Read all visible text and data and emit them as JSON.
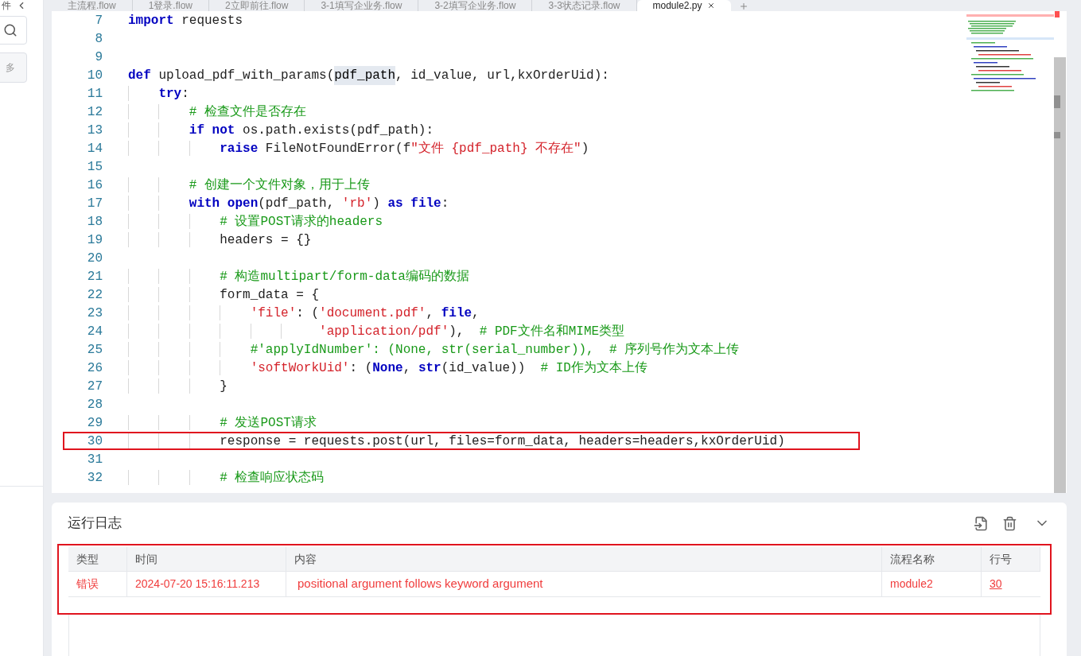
{
  "sidebar": {
    "label": "件",
    "button_label": "多"
  },
  "tabs": [
    {
      "label": "主流程.flow",
      "selected": false
    },
    {
      "label": "1登录.flow",
      "selected": false
    },
    {
      "label": "2立即前往.flow",
      "selected": false
    },
    {
      "label": "3-1填写企业务.flow",
      "selected": false
    },
    {
      "label": "3-2填写企业务.flow",
      "selected": false
    },
    {
      "label": "3-3状态记录.flow",
      "selected": false
    },
    {
      "label": "module2.py",
      "selected": true
    }
  ],
  "editor": {
    "lines": [
      {
        "number": "7",
        "annotated": false,
        "tokens": [
          {
            "kind": "kw",
            "text": "import"
          },
          {
            "kind": "plain",
            "text": " requests"
          }
        ]
      },
      {
        "number": "8",
        "annotated": false
      },
      {
        "number": "9",
        "annotated": false
      },
      {
        "number": "10",
        "annotated": false,
        "tokens": [
          {
            "kind": "kw",
            "text": "def"
          },
          {
            "kind": "plain",
            "text": " upload_pdf_with_params("
          },
          {
            "kind": "match",
            "text": "pdf_path"
          },
          {
            "kind": "plain",
            "text": ", id_value, url,kxOrderUid):"
          }
        ]
      },
      {
        "number": "11",
        "annotated": false,
        "tokens": [
          {
            "kind": "kw",
            "text": "    try"
          },
          {
            "kind": "plain",
            "text": ":"
          }
        ]
      },
      {
        "number": "12",
        "annotated": false,
        "tokens": [
          {
            "kind": "cmt",
            "text": "        # 检查文件是否存在"
          }
        ]
      },
      {
        "number": "13",
        "annotated": false,
        "tokens": [
          {
            "kind": "kw",
            "text": "        if"
          },
          {
            "kind": "kw",
            "text": " not"
          },
          {
            "kind": "plain",
            "text": " os.path.exists(pdf_path):"
          }
        ]
      },
      {
        "number": "14",
        "annotated": false,
        "tokens": [
          {
            "kind": "kw",
            "text": "            raise"
          },
          {
            "kind": "plain",
            "text": " FileNotFoundError(f"
          },
          {
            "kind": "str",
            "text": "\"文件 {pdf_path} 不存在\""
          },
          {
            "kind": "plain",
            "text": ")"
          }
        ]
      },
      {
        "number": "15",
        "annotated": false
      },
      {
        "number": "16",
        "annotated": false,
        "tokens": [
          {
            "kind": "cmt",
            "text": "        # 创建一个文件对象，用于上传"
          }
        ]
      },
      {
        "number": "17",
        "annotated": false,
        "tokens": [
          {
            "kind": "kw",
            "text": "        with"
          },
          {
            "kind": "kw",
            "text": " open"
          },
          {
            "kind": "plain",
            "text": "(pdf_path, "
          },
          {
            "kind": "str",
            "text": "'rb'"
          },
          {
            "kind": "plain",
            "text": ") "
          },
          {
            "kind": "kw",
            "text": "as"
          },
          {
            "kind": "kw",
            "text": " file"
          },
          {
            "kind": "plain",
            "text": ":"
          }
        ]
      },
      {
        "number": "18",
        "annotated": false,
        "tokens": [
          {
            "kind": "cmt",
            "text": "            # 设置POST请求的headers"
          }
        ]
      },
      {
        "number": "19",
        "annotated": false,
        "tokens": [
          {
            "kind": "plain",
            "text": "            headers = {}"
          }
        ]
      },
      {
        "number": "20",
        "annotated": false
      },
      {
        "number": "21",
        "annotated": false,
        "tokens": [
          {
            "kind": "cmt",
            "text": "            # 构造multipart/form-data编码的数据"
          }
        ]
      },
      {
        "number": "22",
        "annotated": false,
        "tokens": [
          {
            "kind": "plain",
            "text": "            form_data = {"
          }
        ]
      },
      {
        "number": "23",
        "annotated": false,
        "tokens": [
          {
            "kind": "str",
            "text": "                'file'"
          },
          {
            "kind": "plain",
            "text": ": ("
          },
          {
            "kind": "str",
            "text": "'document.pdf'"
          },
          {
            "kind": "plain",
            "text": ", "
          },
          {
            "kind": "kw",
            "text": "file"
          },
          {
            "kind": "plain",
            "text": ","
          }
        ]
      },
      {
        "number": "24",
        "annotated": false,
        "tokens": [
          {
            "kind": "str",
            "text": "                         'application/pdf'"
          },
          {
            "kind": "plain",
            "text": "),  "
          },
          {
            "kind": "cmt",
            "text": "# PDF文件名和MIME类型"
          }
        ]
      },
      {
        "number": "25",
        "annotated": false,
        "tokens": [
          {
            "kind": "cmt",
            "text": "                #'applyIdNumber': (None, str(serial_number)),  # 序列号作为文本上传"
          }
        ]
      },
      {
        "number": "26",
        "annotated": false,
        "tokens": [
          {
            "kind": "str",
            "text": "                'softWorkUid'"
          },
          {
            "kind": "plain",
            "text": ": ("
          },
          {
            "kind": "kw",
            "text": "None"
          },
          {
            "kind": "plain",
            "text": ", "
          },
          {
            "kind": "kw",
            "text": "str"
          },
          {
            "kind": "plain",
            "text": "(id_value))  "
          },
          {
            "kind": "cmt",
            "text": "# ID作为文本上传"
          }
        ]
      },
      {
        "number": "27",
        "annotated": false,
        "tokens": [
          {
            "kind": "plain",
            "text": "            }"
          }
        ]
      },
      {
        "number": "28",
        "annotated": false
      },
      {
        "number": "29",
        "annotated": false,
        "tokens": [
          {
            "kind": "cmt",
            "text": "            # 发送POST请求"
          }
        ]
      },
      {
        "number": "30",
        "annotated": true,
        "tokens": [
          {
            "kind": "plain",
            "text": "            response = requests.post(url, files=form_data, headers=headers,kxOrderUid)"
          }
        ]
      },
      {
        "number": "31",
        "annotated": false
      },
      {
        "number": "32",
        "annotated": false,
        "tokens": [
          {
            "kind": "cmt",
            "text": "            # 检查响应状态码"
          }
        ]
      }
    ]
  },
  "log": {
    "title": "运行日志",
    "annotated": true,
    "columns": [
      "类型",
      "时间",
      "内容",
      "流程名称",
      "行号"
    ],
    "rows": [
      {
        "error": true,
        "cells": [
          "错误",
          "2024-07-20 15:16:11.213",
          "positional argument follows keyword argument",
          "module2",
          "30"
        ]
      }
    ]
  }
}
